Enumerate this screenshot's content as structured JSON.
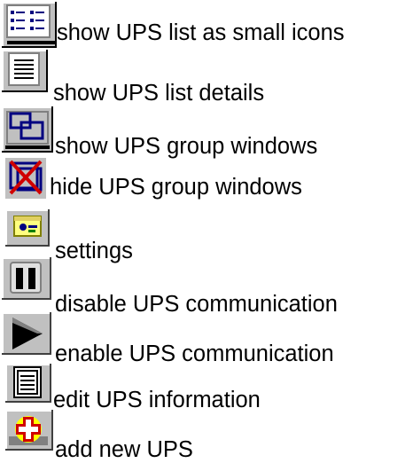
{
  "legend": {
    "items": [
      {
        "icon": "small-icons-view-icon",
        "label": "show UPS list as small icons"
      },
      {
        "icon": "details-view-icon",
        "label": "show UPS list details"
      },
      {
        "icon": "group-windows-icon",
        "label": "show UPS group windows"
      },
      {
        "icon": "hide-group-windows-icon",
        "label": "hide UPS group windows"
      },
      {
        "icon": "settings-icon",
        "label": "settings"
      },
      {
        "icon": "pause-icon",
        "label": "disable UPS communication"
      },
      {
        "icon": "play-icon",
        "label": "enable UPS communication"
      },
      {
        "icon": "edit-info-icon",
        "label": "edit UPS information"
      },
      {
        "icon": "add-ups-icon",
        "label": "add new UPS"
      }
    ]
  },
  "colors": {
    "icon_face": "#c0c0c0",
    "red": "#d00000",
    "navy": "#000080",
    "yellow": "#ffff00",
    "green": "#008000"
  }
}
